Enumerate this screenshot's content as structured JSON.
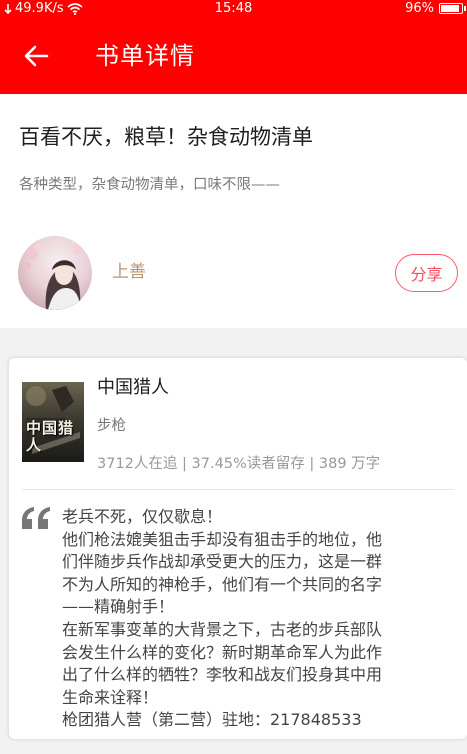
{
  "status_bar": {
    "speed": "49.9K/s",
    "time": "15:48",
    "battery_text": "96%",
    "battery_level": 0.96
  },
  "app_bar": {
    "title": "书单详情",
    "back_icon": "arrow-left-icon"
  },
  "booklist": {
    "title": "百看不厌，粮草！杂食动物清单",
    "description": "各种类型，杂食动物清单，口味不限——",
    "author": "上善",
    "share_label": "分享"
  },
  "books": [
    {
      "title": "中国猎人",
      "category": "步枪",
      "stats": "3712人在追 | 37.45%读者留存 | 389 万字",
      "cover_text": "中国猎人",
      "review_lines": [
        "老兵不死，仅仅歇息！",
        "他们枪法媲美狙击手却没有狙击手的地位，他",
        "们伴随步兵作战却承受更大的压力，这是一群",
        "不为人所知的神枪手，他们有一个共同的名字",
        "——精确射手！",
        "在新军事变革的大背景之下，古老的步兵部队",
        "会发生什么样的变化？新时期革命军人为此作",
        "出了什么样的牺牲？李牧和战友们投身其中用",
        "生命来诠释！",
        "枪团猎人营（第二营）驻地：217848533"
      ]
    }
  ],
  "colors": {
    "primary": "#ff0000",
    "author": "#b6956a",
    "share_border": "#ff5a6e"
  }
}
